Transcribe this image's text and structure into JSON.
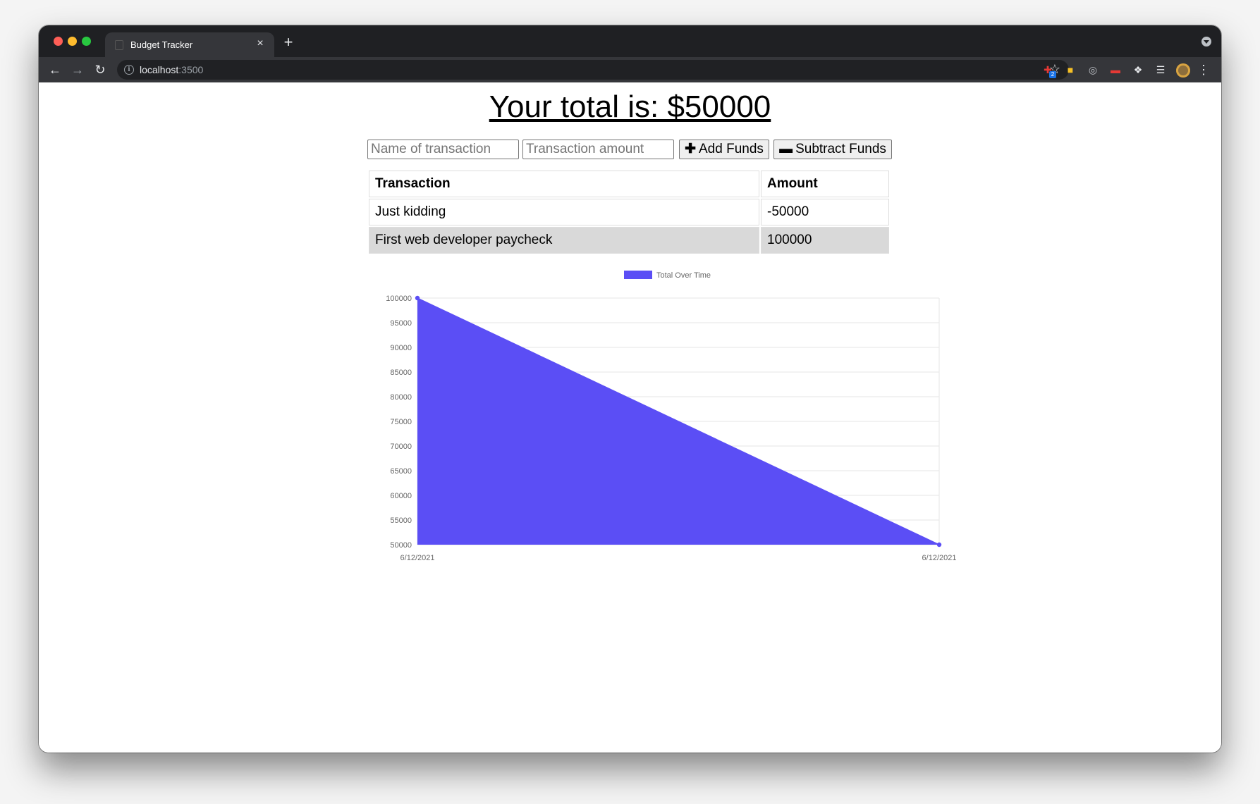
{
  "browser": {
    "tab_title": "Budget Tracker",
    "tab_close": "×",
    "new_tab": "+",
    "url_host": "localhost",
    "url_port": ":3500",
    "extension_badge": "2"
  },
  "page": {
    "total_text": "Your total is: $50000",
    "name_placeholder": "Name of transaction",
    "amount_placeholder": "Transaction amount",
    "add_label": "Add Funds",
    "subtract_label": "Subtract Funds",
    "table": {
      "headers": [
        "Transaction",
        "Amount"
      ],
      "rows": [
        [
          "Just kidding",
          "-50000"
        ],
        [
          "First web developer paycheck",
          "100000"
        ]
      ]
    }
  },
  "colors": {
    "series_fill": "#5b4ef5",
    "grid": "#e6e6e6"
  },
  "chart_data": {
    "type": "area",
    "x": [
      "6/12/2021",
      "6/12/2021"
    ],
    "series": [
      {
        "name": "Total Over Time",
        "values": [
          100000,
          50000
        ]
      }
    ],
    "ylim": [
      50000,
      100000
    ],
    "yticks": [
      100000,
      95000,
      90000,
      85000,
      80000,
      75000,
      70000,
      65000,
      60000,
      55000,
      50000
    ],
    "grid": true,
    "legend_position": "top"
  }
}
